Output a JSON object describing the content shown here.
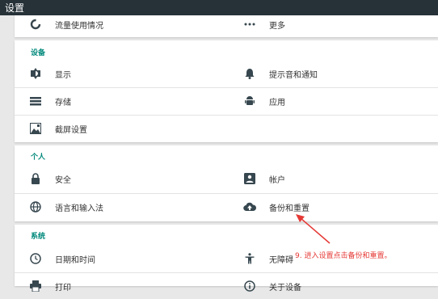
{
  "topbar": {
    "title": "设置"
  },
  "sections": {
    "top": {
      "items": [
        {
          "label": "流量使用情况",
          "icon": "data-usage-icon"
        },
        {
          "label": "更多",
          "icon": "more-icon"
        }
      ]
    },
    "device": {
      "title": "设备",
      "items": [
        {
          "label": "显示",
          "icon": "brightness-icon"
        },
        {
          "label": "提示音和通知",
          "icon": "bell-icon"
        },
        {
          "label": "存储",
          "icon": "storage-icon"
        },
        {
          "label": "应用",
          "icon": "android-icon"
        },
        {
          "label": "截屏设置",
          "icon": "screenshot-icon"
        }
      ]
    },
    "personal": {
      "title": "个人",
      "items": [
        {
          "label": "安全",
          "icon": "lock-icon"
        },
        {
          "label": "帐户",
          "icon": "account-icon"
        },
        {
          "label": "语言和输入法",
          "icon": "globe-icon"
        },
        {
          "label": "备份和重置",
          "icon": "cloud-upload-icon"
        }
      ]
    },
    "system": {
      "title": "系统",
      "items": [
        {
          "label": "日期和时间",
          "icon": "clock-icon"
        },
        {
          "label": "无障碍",
          "icon": "accessibility-icon"
        },
        {
          "label": "打印",
          "icon": "print-icon"
        },
        {
          "label": "关于设备",
          "icon": "info-icon"
        }
      ]
    }
  },
  "annotation": {
    "text": "9. 进入设置点击备份和重置。",
    "color": "#e53935"
  },
  "colors": {
    "accent": "#00897b",
    "icon": "#37474f",
    "topbar": "#263238"
  }
}
